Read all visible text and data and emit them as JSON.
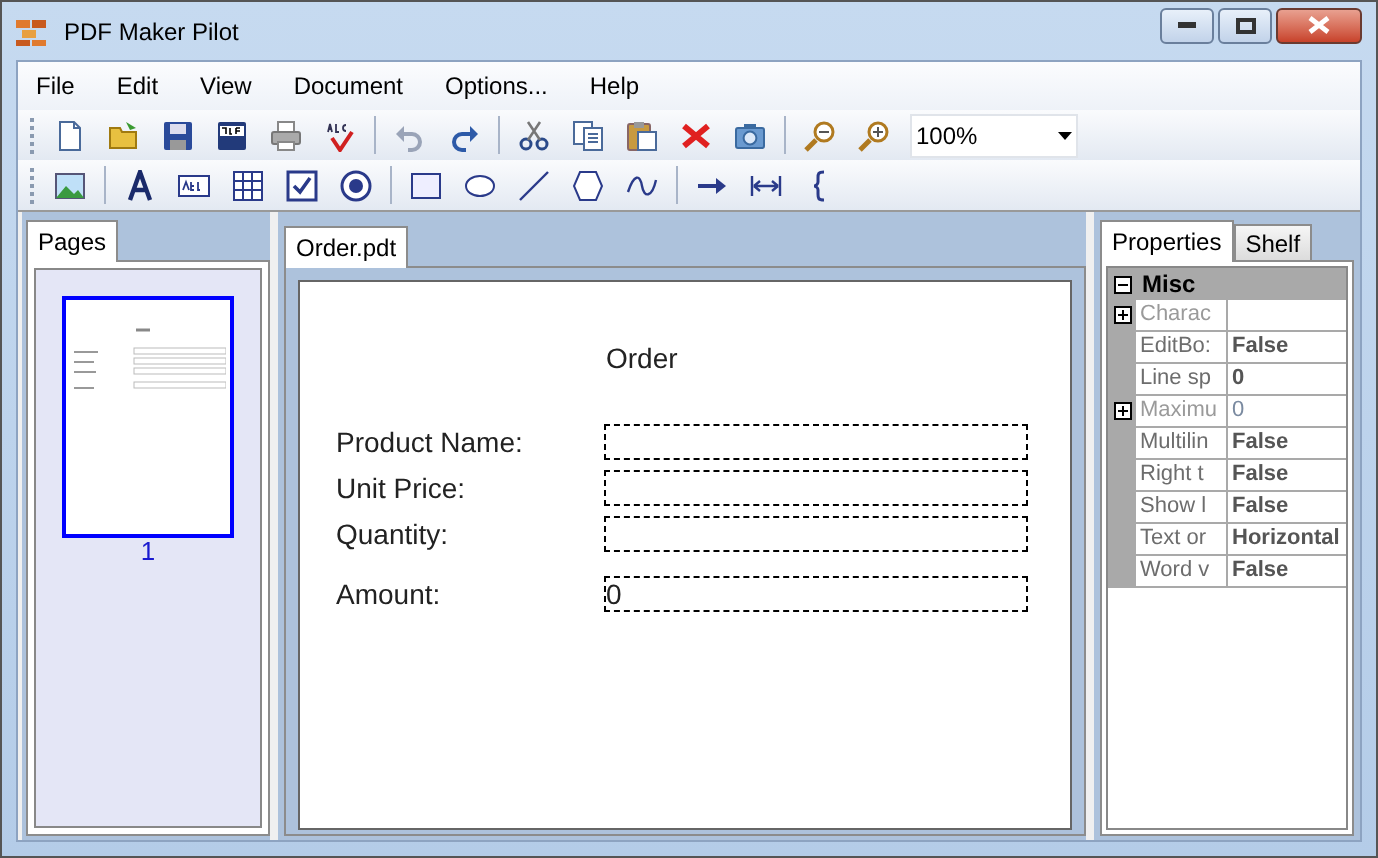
{
  "window": {
    "title": "PDF Maker Pilot"
  },
  "menu": [
    "File",
    "Edit",
    "View",
    "Document",
    "Options...",
    "Help"
  ],
  "zoom": {
    "value": "100%"
  },
  "pages_panel": {
    "tabs": [
      {
        "label": "Pages",
        "selected": true
      }
    ],
    "pages": [
      {
        "number": "1",
        "selected": true
      }
    ]
  },
  "document": {
    "tabs": [
      {
        "label": "Order.pdt",
        "selected": true
      }
    ],
    "title": "Order",
    "fields": [
      {
        "label": "Product Name:"
      },
      {
        "label": "Unit Price:"
      },
      {
        "label": "Quantity:"
      },
      {
        "label": "Amount:",
        "value": "0"
      }
    ]
  },
  "properties_panel": {
    "tabs": [
      {
        "label": "Properties",
        "selected": true
      },
      {
        "label": "Shelf",
        "selected": false
      }
    ],
    "category": {
      "name": "Misc",
      "expanded": true
    },
    "rows": [
      {
        "name": "Charac",
        "value": "",
        "expandable": true,
        "modified": false
      },
      {
        "name": "EditBo:",
        "value": "False",
        "expandable": false,
        "modified": true
      },
      {
        "name": "Line sp",
        "value": "0",
        "expandable": false,
        "modified": true
      },
      {
        "name": "Maximu",
        "value": "0",
        "expandable": true,
        "modified": false
      },
      {
        "name": "Multilin",
        "value": "False",
        "expandable": false,
        "modified": true
      },
      {
        "name": "Right t",
        "value": "False",
        "expandable": false,
        "modified": true
      },
      {
        "name": "Show l",
        "value": "False",
        "expandable": false,
        "modified": true
      },
      {
        "name": "Text or",
        "value": "Horizontal",
        "expandable": false,
        "modified": true
      },
      {
        "name": "Word v",
        "value": "False",
        "expandable": false,
        "modified": true
      }
    ]
  }
}
